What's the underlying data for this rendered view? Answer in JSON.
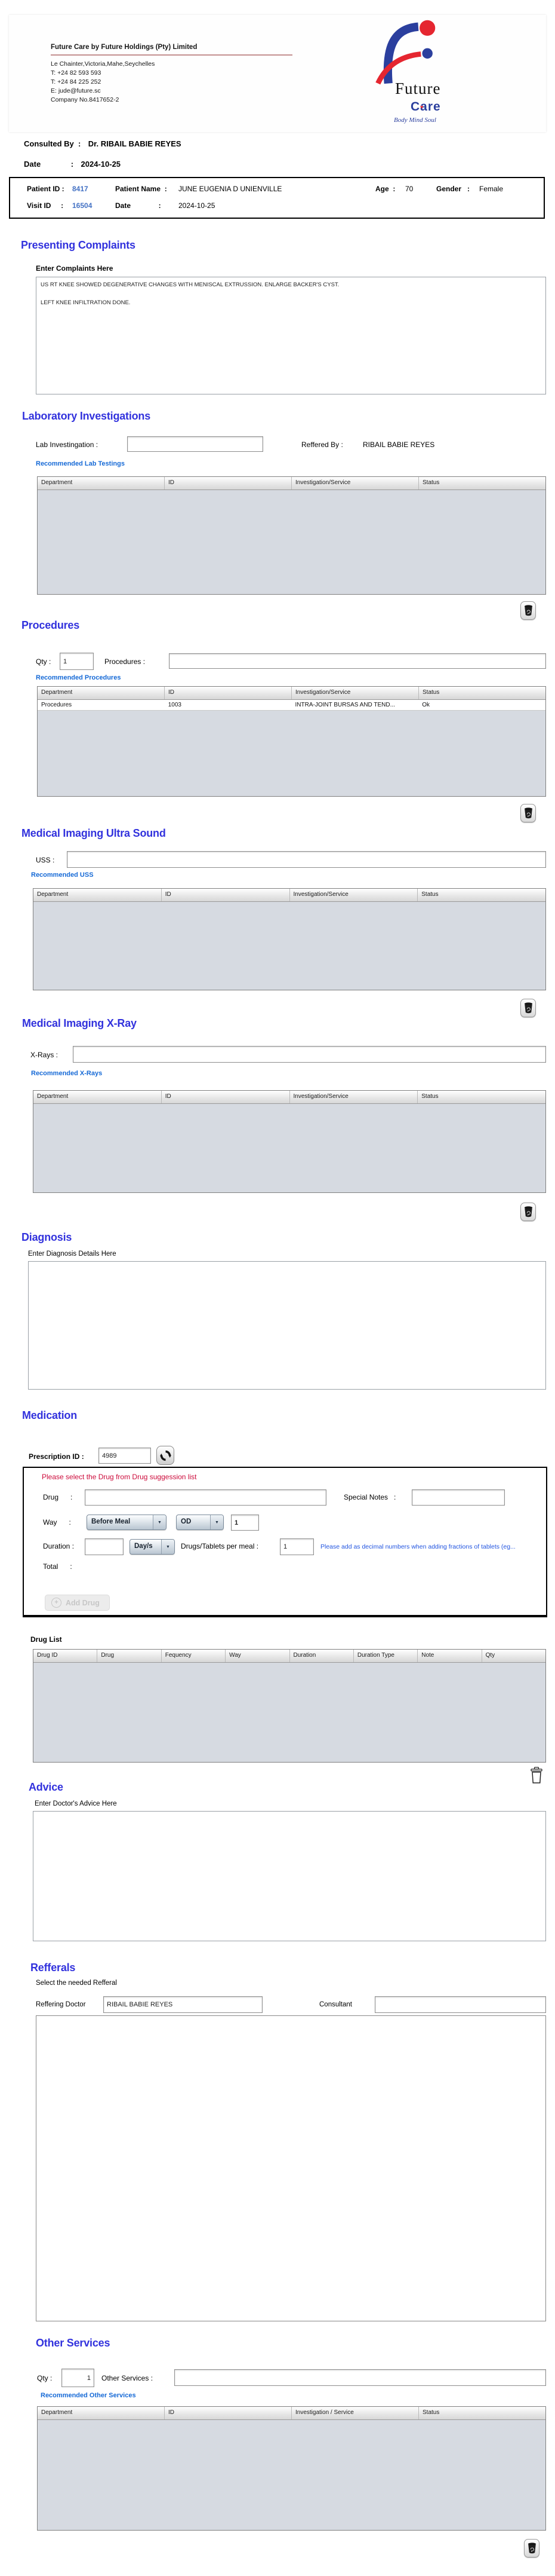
{
  "colors": {
    "heading_blue": "#3232dd",
    "link_blue": "#1569d6",
    "id_blue": "#4472c4",
    "warning_red": "#cc0a3a",
    "hint_blue": "#2255e0",
    "logo_blue": "#2b3f9e",
    "logo_red": "#e52630",
    "table_body_gray": "#d6dae1"
  },
  "header": {
    "company_title": "Future Care by Future Holdings (Pty) Limited",
    "address": "Le Chainter,Victoria,Mahe,Seychelles",
    "phone1": "T: +24  82 593 593",
    "phone2": "T: +24  84 225 252",
    "email": "E: jude@future.sc",
    "company_no": "Company No.8417652-2",
    "logo": {
      "word1": "Future",
      "word2": "Care",
      "heart": "♥",
      "tagline": "Body Mind Soul"
    }
  },
  "consultation": {
    "consulted_by_label": "Consulted By  :",
    "consulted_by_value": "Dr.  RIBAIL BABIE REYES",
    "date_label": "Date              :",
    "date_value": "2024-10-25"
  },
  "patient": {
    "patient_id_label": "Patient ID :",
    "patient_id": "8417",
    "patient_name_label": "Patient Name  :",
    "patient_name": "JUNE EUGENIA D UNIENVILLE",
    "age_label": "Age  :",
    "age": "70",
    "gender_label": "Gender   :",
    "gender": "Female",
    "visit_id_label": "Visit ID     :",
    "visit_id": "16504",
    "visit_date_label": "Date              :",
    "visit_date": "2024-10-25"
  },
  "presenting_complaints": {
    "title": "Presenting Complaints",
    "label": "Enter Complaints Here",
    "text": "US RT KNEE SHOWED DEGENERATIVE CHANGES WITH MENISCAL EXTRUSSION. ENLARGE BACKER'S CYST.\n\nLEFT KNEE INFILTRATION DONE."
  },
  "laboratory": {
    "title": "Laboratory  Investigations",
    "lab_label": "Lab Investingation :",
    "lab_value": "",
    "reffered_by_label": "Reffered By :",
    "reffered_by_value": "RIBAIL BABIE REYES",
    "link": "Recommended Lab Testings",
    "columns": [
      "Department",
      "ID",
      "Investigation/Service",
      "Status"
    ],
    "rows": []
  },
  "procedures": {
    "title": "Procedures",
    "qty_label": "Qty :",
    "qty_value": "1",
    "procedures_label": "Procedures :",
    "procedures_value": "",
    "link": "Recommended Procedures",
    "columns": [
      "Department",
      "ID",
      "Investigation/Service",
      "Status"
    ],
    "rows": [
      [
        "Procedures",
        "1003",
        "INTRA-JOINT BURSAS AND TEND...",
        "Ok"
      ]
    ]
  },
  "ultrasound": {
    "title": "Medical Imaging Ultra Sound",
    "uss_label": "USS :",
    "uss_value": "",
    "link": "Recommended USS",
    "columns": [
      "Department",
      "ID",
      "Investigation/Service",
      "Status"
    ],
    "rows": []
  },
  "xray": {
    "title": "Medical Imaging X-Ray",
    "xrays_label": "X-Rays :",
    "xrays_value": "",
    "link": "Recommended X-Rays",
    "columns": [
      "Department",
      "ID",
      "Investigation/Service",
      "Status"
    ],
    "rows": []
  },
  "diagnosis": {
    "title": "Diagnosis",
    "label": "Enter Diagnosis Details Here",
    "text": ""
  },
  "medication": {
    "title": "Medication",
    "prescription_id_label": "Prescription ID :",
    "prescription_id": "4989",
    "warning": "Please select the Drug from Drug suggession list",
    "drug_label": "Drug      :",
    "drug_value": "",
    "special_notes_label": "Special Notes   :",
    "special_notes_value": "",
    "way_label": "Way      :",
    "meal_select": "Before Meal",
    "frequency_select": "OD",
    "frequency_qty": "1",
    "duration_label": "Duration :",
    "duration_value": "",
    "duration_unit": "Day/s",
    "per_meal_label": "Drugs/Tablets per meal :",
    "per_meal_value": "1",
    "hint": "Please add as decimal numbers when adding fractions of tablets (eg...",
    "total_label": "Total      :",
    "add_drug_label": "Add Drug",
    "plus": "+",
    "dd_arrow": "▼",
    "drug_list_label": "Drug List",
    "columns": [
      "Drug ID",
      "Drug",
      "Fequency",
      "Way",
      "Duration",
      "Duration Type",
      "Note",
      "Qty"
    ],
    "rows": []
  },
  "advice": {
    "title": "Advice",
    "label": "Enter Doctor's Advice Here",
    "text": ""
  },
  "refferals": {
    "title": "Refferals",
    "label": "Select the needed Refferal",
    "reffering_doctor_label": "Reffering Doctor",
    "reffering_doctor_value": "RIBAIL BABIE REYES",
    "consultant_label": "Consultant",
    "consultant_value": ""
  },
  "other_services": {
    "title": "Other Services",
    "qty_label": "Qty :",
    "qty_value": "1",
    "services_label": "Other Services :",
    "services_value": "",
    "link": "Recommended Other Services",
    "columns": [
      "Department",
      "ID",
      "Investigation / Service",
      "Status"
    ],
    "rows": []
  }
}
